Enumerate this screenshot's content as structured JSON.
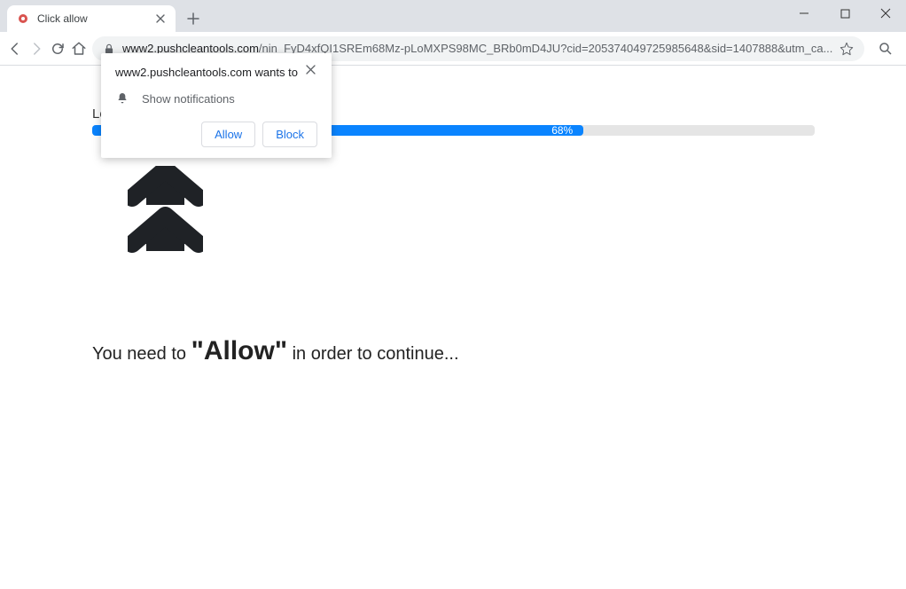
{
  "window": {
    "tab_title": "Click allow",
    "url_domain": "www2.pushcleantools.com",
    "url_path": "/nin_FyD4xfQI1SREm68Mz-pLoMXPS98MC_BRb0mD4JU?cid=205374049725985648&sid=1407888&utm_ca..."
  },
  "permission": {
    "origin_text": "www2.pushcleantools.com wants to",
    "show_notifications": "Show notifications",
    "allow": "Allow",
    "block": "Block"
  },
  "page": {
    "loading": "Lo",
    "progress_percent": 68,
    "progress_text": "68%",
    "message_prefix": "You need to ",
    "message_emph": "\"Allow\"",
    "message_suffix": " in order to continue..."
  }
}
